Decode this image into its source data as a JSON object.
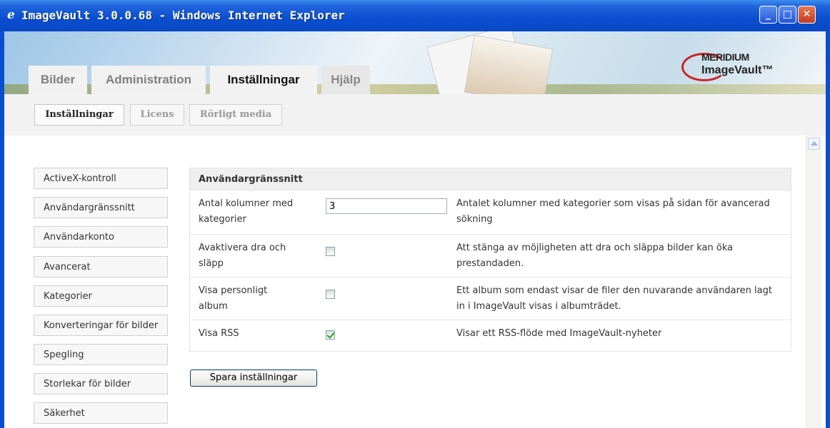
{
  "window": {
    "title": "ImageVault 3.0.0.68 - Windows Internet Explorer",
    "buttons": {
      "minimize": "_",
      "maximize": "□",
      "close": "✕"
    }
  },
  "logo": {
    "line1": "MERIDIUM",
    "line2": "ImageVault™"
  },
  "tabs": [
    {
      "label": "Bilder",
      "active": false
    },
    {
      "label": "Administration",
      "active": false
    },
    {
      "label": "Inställningar",
      "active": true
    },
    {
      "label": "Hjälp",
      "active": false
    }
  ],
  "subnav": [
    {
      "label": "Inställningar",
      "active": true
    },
    {
      "label": "Licens",
      "active": false
    },
    {
      "label": "Rörligt media",
      "active": false
    }
  ],
  "sidebar": {
    "items": [
      {
        "label": "ActiveX-kontroll"
      },
      {
        "label": "Användargränssnitt"
      },
      {
        "label": "Användarkonto"
      },
      {
        "label": "Avancerat"
      },
      {
        "label": "Kategorier"
      },
      {
        "label": "Konverteringar för bilder"
      },
      {
        "label": "Spegling"
      },
      {
        "label": "Storlekar för bilder"
      },
      {
        "label": "Säkerhet"
      }
    ]
  },
  "panel": {
    "title": "Användargränssnitt",
    "rows": [
      {
        "label": "Antal kolumner med kategorier",
        "type": "text",
        "value": "3",
        "description": "Antalet kolumner med kategorier som visas på sidan för avancerad sökning"
      },
      {
        "label": "Avaktivera dra och släpp",
        "type": "checkbox",
        "checked": false,
        "description": "Att stänga av möjligheten att dra och släppa bilder kan öka prestandaden."
      },
      {
        "label": "Visa personligt album",
        "type": "checkbox",
        "checked": false,
        "description": "Ett album som endast visar de filer den nuvarande användaren lagt in i ImageVault visas i albumträdet."
      },
      {
        "label": "Visa RSS",
        "type": "checkbox",
        "checked": true,
        "description": "Visar ett RSS-flöde med ImageVault-nyheter"
      }
    ]
  },
  "save_button": "Spara inställningar",
  "colors": {
    "titlebar": "#0a4ed0",
    "close": "#c23a1c",
    "checkmark": "#21a121"
  }
}
